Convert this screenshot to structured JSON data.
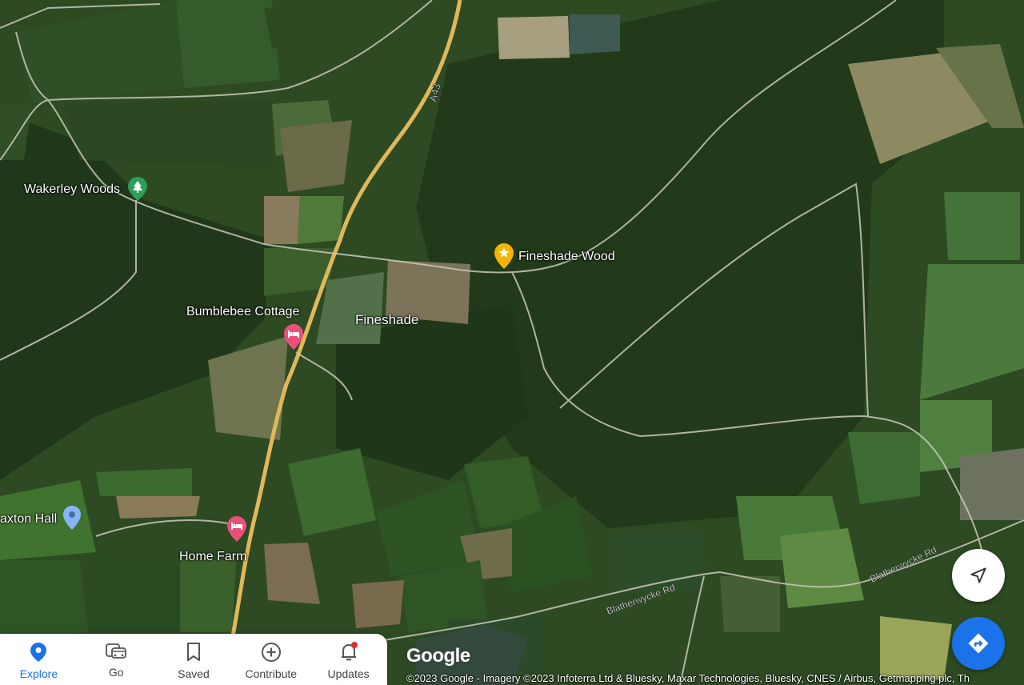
{
  "map": {
    "roads": [
      "A43",
      "Blatherwycke Rd",
      "Blatherwycke Rd"
    ],
    "places": {
      "wakerley": "Wakerley Woods",
      "fineshade_wood": "Fineshade Wood",
      "bumblebee": "Bumblebee Cottage",
      "fineshade": "Fineshade",
      "laxton": "axton Hall",
      "home_farm": "Home Farm"
    },
    "icons": {
      "wakerley": "tree-icon",
      "fineshade_wood": "star-icon",
      "bumblebee": "bed-icon",
      "laxton": "location-pin-icon",
      "home_farm": "bed-icon"
    }
  },
  "nav": {
    "items": [
      {
        "label": "Explore",
        "icon": "location-pin-icon",
        "active": true
      },
      {
        "label": "Go",
        "icon": "car-icon"
      },
      {
        "label": "Saved",
        "icon": "bookmark-icon"
      },
      {
        "label": "Contribute",
        "icon": "plus-circle-icon"
      },
      {
        "label": "Updates",
        "icon": "bell-icon",
        "badge": true
      }
    ]
  },
  "logo": "Google",
  "attribution": "©2023 Google - Imagery ©2023 Infoterra Ltd & Bluesky, Maxar Technologies, Bluesky, CNES / Airbus, Getmapping plc, Th",
  "colors": {
    "accent": "#1a73e8",
    "lodging_pin": "#e8507a",
    "star_pin": "#f4b400",
    "park_pin": "#2e9e5b",
    "landmark_pin": "#8ab4f8",
    "badge": "#d93025"
  }
}
